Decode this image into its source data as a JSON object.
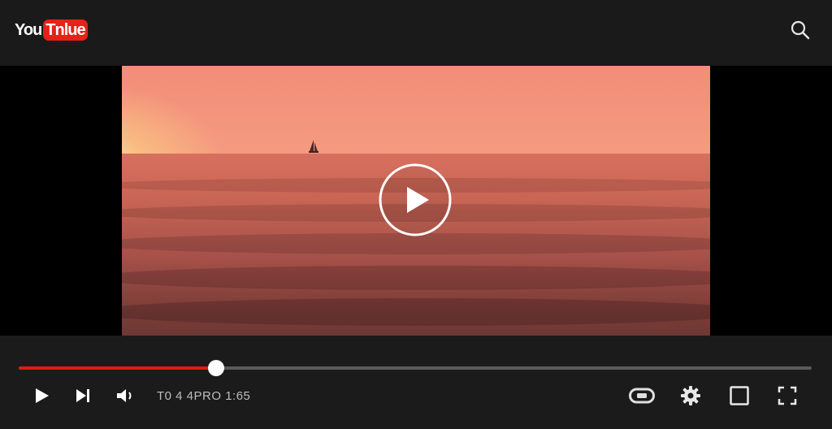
{
  "header": {
    "logo_part1": "You",
    "logo_part2": "Tnlue",
    "logo_color": "#e62117",
    "search_icon": "search-icon"
  },
  "video": {
    "state": "paused",
    "center_icon": "play-circle-icon",
    "accent_color": "#e3190f"
  },
  "controls": {
    "progress_fraction": 0.249,
    "time_display": "T0 4 4PRO 1:65",
    "buttons": {
      "play": "play-icon",
      "next": "skip-next-icon",
      "volume": "volume-icon",
      "captions": "captions-icon",
      "settings": "gear-icon",
      "miniplayer": "square-icon",
      "fullscreen": "fullscreen-icon"
    }
  }
}
